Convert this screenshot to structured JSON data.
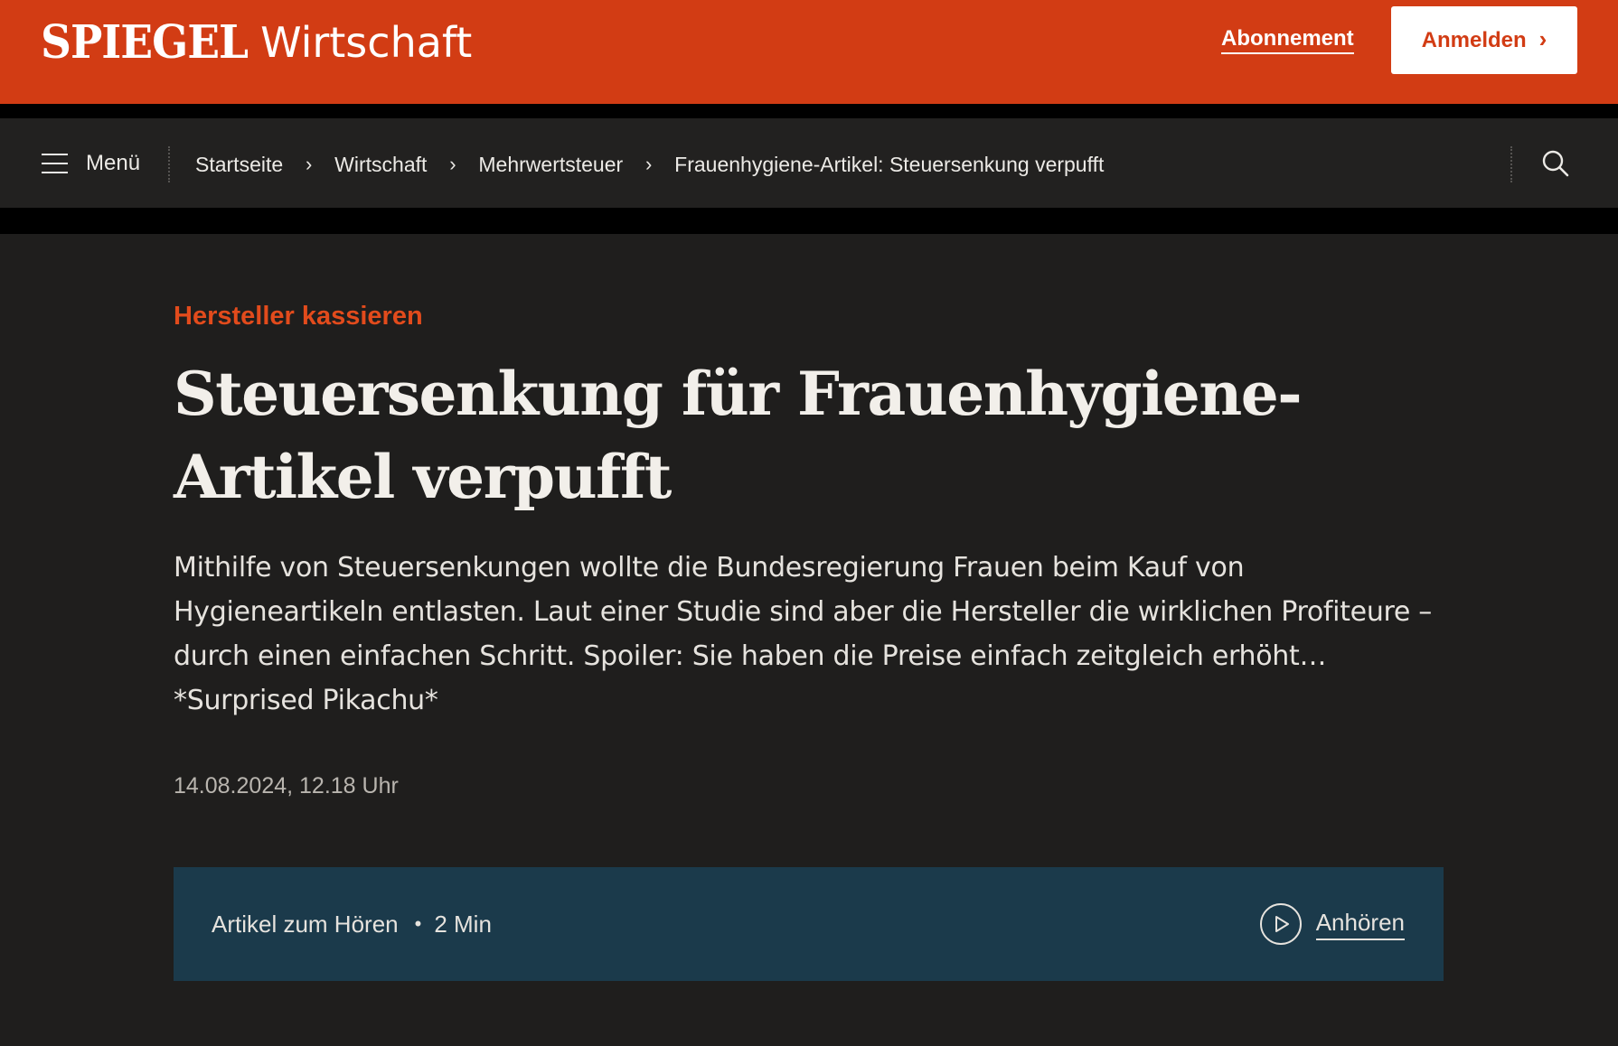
{
  "header": {
    "logo": "SPIEGEL",
    "section": "Wirtschaft",
    "subscription_link": "Abonnement",
    "login_button": "Anmelden",
    "accent_color": "#d23c14"
  },
  "nav": {
    "menu_label": "Menü",
    "breadcrumb": [
      "Startseite",
      "Wirtschaft",
      "Mehrwertsteuer",
      "Frauenhygiene-Artikel: Steuersenkung verpufft"
    ],
    "breadcrumb_separator": "›",
    "search_icon": "search-icon"
  },
  "article": {
    "kicker": "Hersteller kassieren",
    "headline": "Steuersenkung für Frauenhygiene-Artikel verpufft",
    "intro": "Mithilfe von Steuersenkungen wollte die Bundesregierung Frauen beim Kauf von Hygieneartikeln entlasten. Laut einer Studie sind aber die Hersteller die wirklichen Profiteure – durch einen einfachen Schritt. Spoiler: Sie haben die Preise einfach zeitgleich erhöht… *Surprised Pikachu*",
    "timestamp": "14.08.2024, 12.18 Uhr",
    "kicker_color": "#e24b1c"
  },
  "audio": {
    "label": "Artikel zum Hören",
    "separator": "•",
    "duration": "2 Min",
    "listen_label": "Anhören",
    "box_color": "#1b3a4b",
    "play_icon": "play-icon"
  }
}
